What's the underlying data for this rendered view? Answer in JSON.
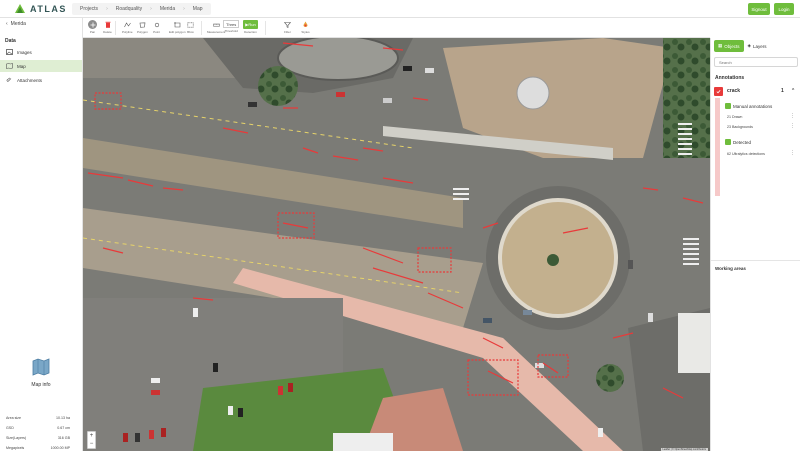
{
  "app": {
    "logo_text": "ATLAS",
    "brand_color": "#6fbd3c",
    "detection_color": "#e83a3a"
  },
  "breadcrumb": {
    "items": [
      "Projects",
      "Roadquality",
      "Merida",
      "Map"
    ]
  },
  "header": {
    "signout_label": "Signout",
    "login_label": "Login"
  },
  "left": {
    "back_label": "Merida",
    "section_title": "Data",
    "nav": [
      {
        "label": "Images",
        "icon": "images-icon"
      },
      {
        "label": "Map",
        "icon": "map-icon"
      },
      {
        "label": "Attachments",
        "icon": "attachment-icon"
      }
    ],
    "mapinfo_title": "Map info",
    "info": [
      {
        "k": "Area size",
        "v": "10.13 ha"
      },
      {
        "k": "GSD",
        "v": "0.67 cm"
      },
      {
        "k": "Size(Layers)",
        "v": "316 GB"
      },
      {
        "k": "Megapixels",
        "v": "1000.00 MP"
      }
    ]
  },
  "toolbar": {
    "tools": [
      {
        "label": "Pan",
        "icon": "pan-icon"
      },
      {
        "label": "Delete",
        "icon": "trash-icon"
      },
      {
        "label": "Polyline",
        "icon": "polyline-icon"
      },
      {
        "label": "Polygon",
        "icon": "polygon-icon"
      },
      {
        "label": "Point",
        "icon": "point-icon"
      },
      {
        "label": "Edit polygon",
        "icon": "edit-polygon-icon"
      },
      {
        "label": "Bbox",
        "icon": "bbox-icon"
      },
      {
        "label": "Measurement",
        "icon": "measure-icon"
      },
      {
        "label": "Threshold",
        "icon": "threshold-icon"
      },
      {
        "label": "Detection",
        "icon": "detection-icon"
      },
      {
        "label": "Filter",
        "icon": "filter-icon"
      },
      {
        "label": "Styles",
        "icon": "styles-icon"
      }
    ],
    "mode_label": "Thres",
    "run_label": "Run"
  },
  "right": {
    "tabs": [
      {
        "label": "Objects",
        "active": true
      },
      {
        "label": "Layers",
        "active": false
      }
    ],
    "search_placeholder": "Search",
    "annotations_title": "Annotations",
    "class": {
      "name": "crack",
      "count": "1"
    },
    "manual_title": "Manual annotations",
    "manual_items": [
      "21 Drawn",
      "23 Backgrounds"
    ],
    "detected_title": "Detected",
    "detected_items": [
      "62 Ultralytics detections"
    ],
    "working_title": "Working areas"
  },
  "map": {
    "attribution": "Leaflet | © OpenStreetMap contributors",
    "zoom_in": "+",
    "zoom_out": "−"
  }
}
